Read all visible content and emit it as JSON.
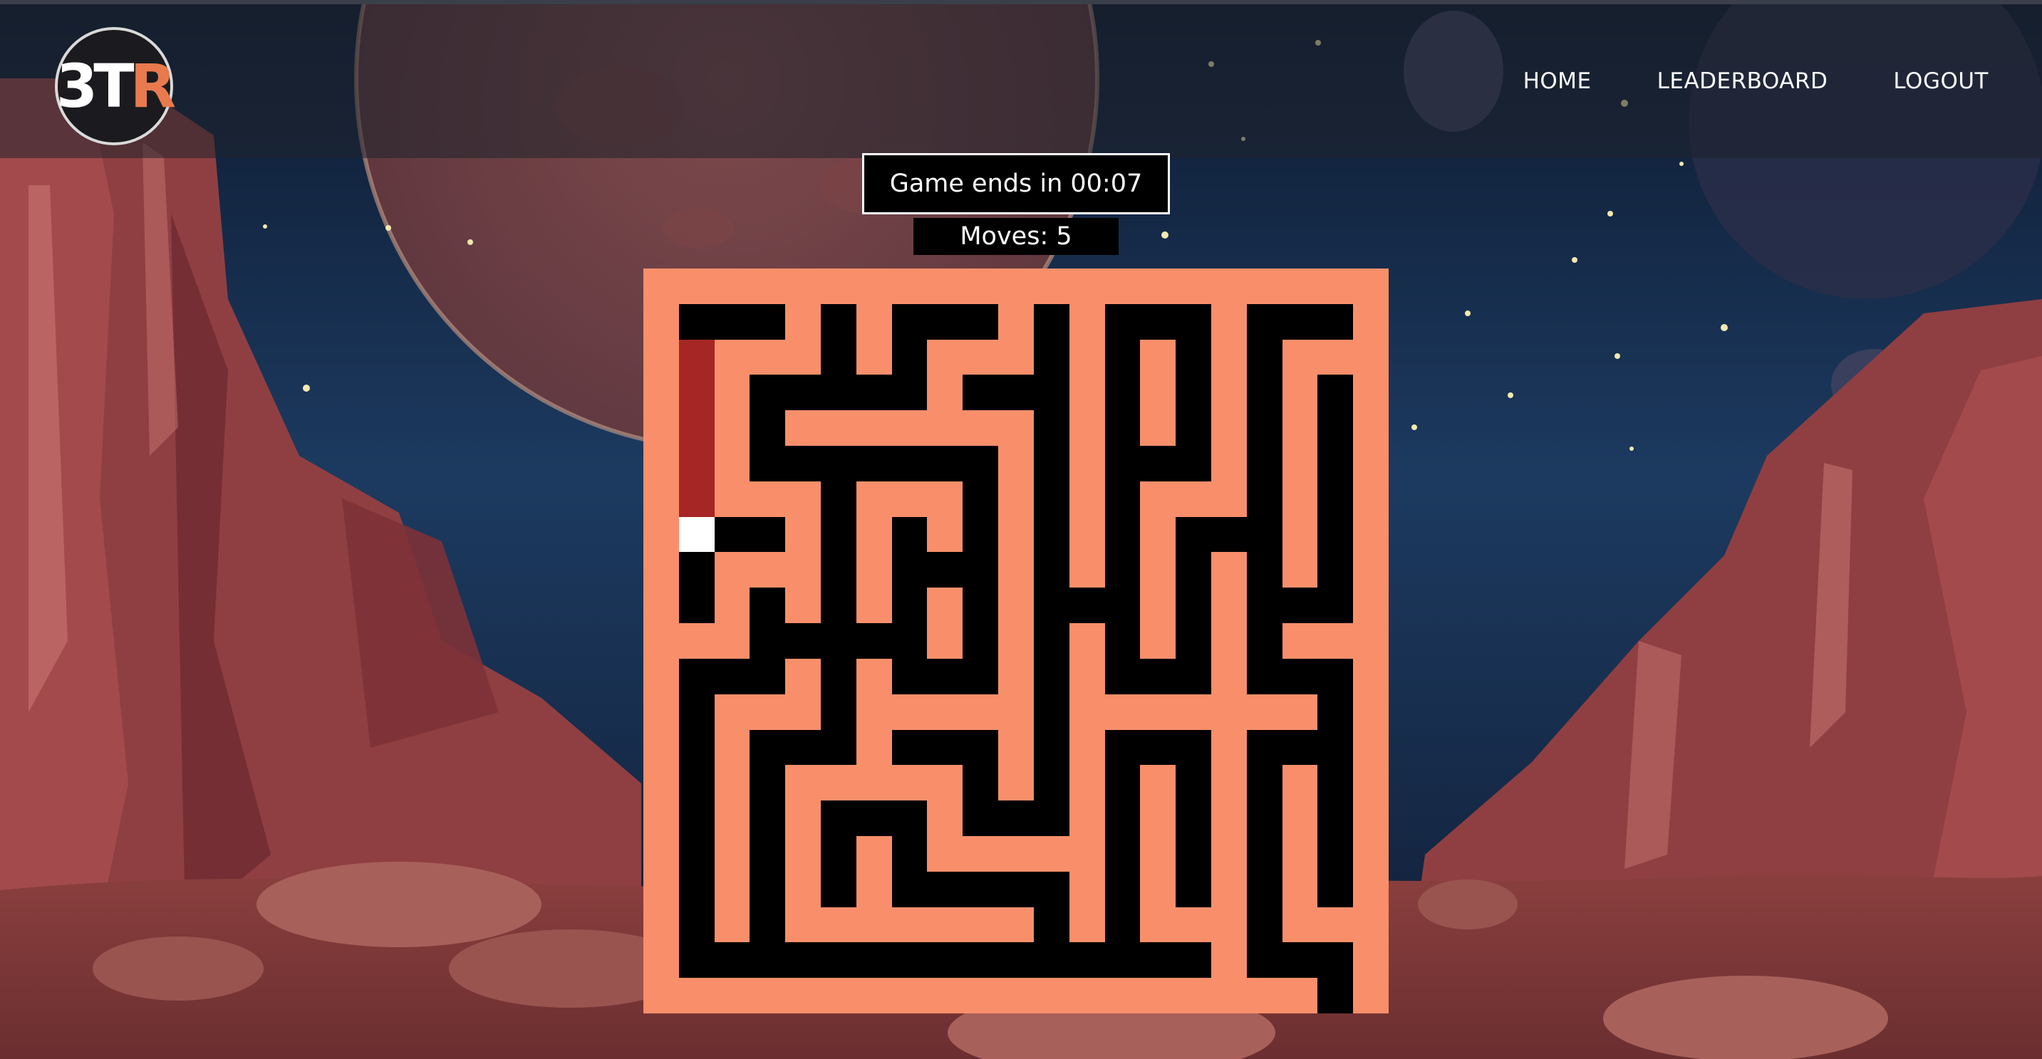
{
  "logo": {
    "part1": "3T",
    "part2": "R"
  },
  "nav": [
    {
      "label": "HOME"
    },
    {
      "label": "LEADERBOARD"
    },
    {
      "label": "LOGOUT"
    }
  ],
  "game": {
    "timer_label": "Game ends in 00:07",
    "moves_label": "Moves: 5"
  },
  "colors": {
    "wall": "#f88f6a",
    "path": "#000000",
    "trail": "#a52624",
    "player": "#ffffff"
  },
  "maze": {
    "legend": "W = wall, . = open path, T = visited trail, P = player",
    "rows": [
      "WWWWWWWWWWWWWWWWWWWWW",
      "W...W.W...W.W...W...W",
      "WTWWW.W.WWW.W.W.W.WWW",
      "WTW.....W...W.W.W.W.W",
      "WTW.WWWWWWW.W.W.W.W.W",
      "WTW.......W.W...W.W.W",
      "WTWWW.WWW.W.W.WWW.W.W",
      "WP..W.W.W.W.W.W...W.W",
      "W.WWW.W...W.W.W.W.W.W",
      "W.W.W.W.W.W...W.W...W",
      "WWW.....W.W.W.W.W.WWW",
      "W...W.W...W.W...W...W",
      "W.WWW.WWWWW.WWWWWWW.W",
      "W.W...W...W.W...W...W",
      "W.W.WWWWW.W.W.W.W.W.W",
      "W.W.W...W...W.W.W.W.W",
      "W.W.W.W.WWWWW.W.W.W.W",
      "W.W.W.W.....W.W.W.W.W",
      "W.W.WWWWWWW.W.WWW.WWW",
      "W...............W...W",
      "WWWWWWWWWWWWWWWWWWW.W"
    ]
  }
}
